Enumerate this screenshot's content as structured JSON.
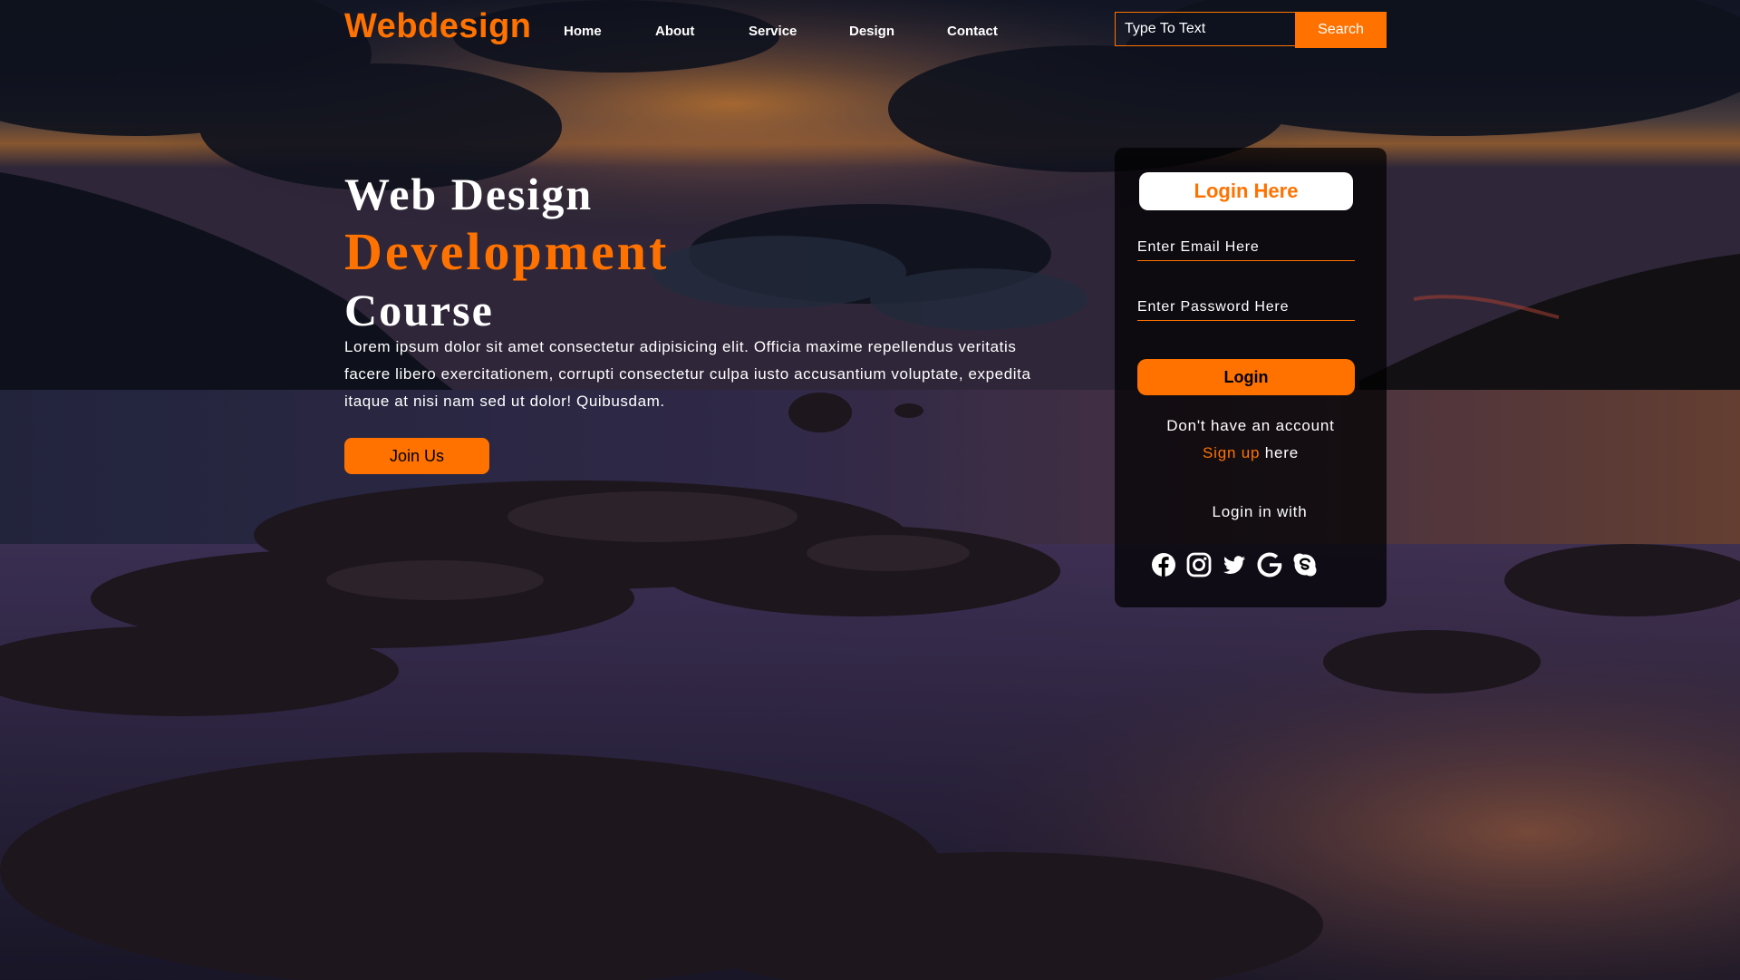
{
  "brand": {
    "logo": "Webdesign",
    "accent_color": "#ff7200"
  },
  "nav": {
    "items": [
      {
        "label": "Home"
      },
      {
        "label": "About"
      },
      {
        "label": "Service"
      },
      {
        "label": "Design"
      },
      {
        "label": "Contact"
      }
    ]
  },
  "search": {
    "placeholder": "Type To Text",
    "button_label": "Search"
  },
  "hero": {
    "title_line1": "Web Design",
    "title_line2": "Development",
    "title_line3": "Course",
    "description": "Lorem ipsum dolor sit amet consectetur adipisicing elit. Officia maxime repellendus veritatis facere libero exercitationem, corrupti consectetur culpa iusto accusantium voluptate, expedita itaque at nisi nam sed ut dolor! Quibusdam.",
    "cta_label": "Join Us"
  },
  "login": {
    "title": "Login Here",
    "email_placeholder": "Enter Email Here",
    "password_placeholder": "Enter Password Here",
    "button_label": "Login",
    "no_account_text": "Don't have an account",
    "signup_link": "Sign up",
    "signup_suffix": " here",
    "login_with": "Login in with",
    "social_icons": [
      "facebook-icon",
      "instagram-icon",
      "twitter-icon",
      "google-icon",
      "skype-icon"
    ]
  }
}
